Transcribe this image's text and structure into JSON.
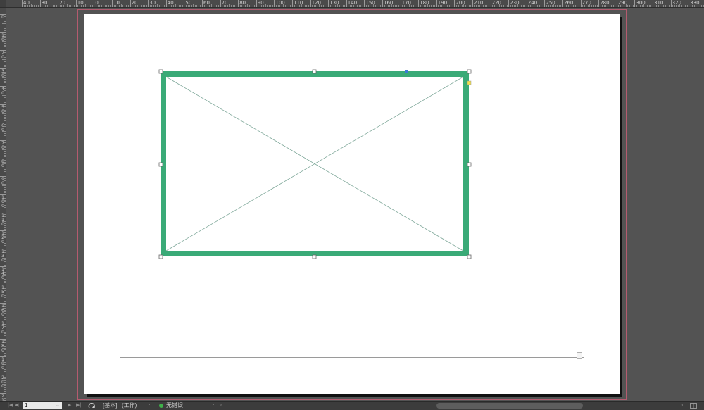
{
  "ruler": {
    "horizontal_labels": [
      "40",
      "30",
      "20",
      "10",
      "0",
      "10",
      "20",
      "30",
      "40",
      "50",
      "60",
      "70",
      "80",
      "90",
      "100",
      "110",
      "120",
      "130",
      "140",
      "150",
      "160",
      "170",
      "180",
      "190",
      "200",
      "210",
      "220",
      "230",
      "240",
      "250",
      "260",
      "270",
      "280",
      "290",
      "300",
      "310",
      "320",
      "330"
    ],
    "vertical_labels": [
      "0",
      "10",
      "20",
      "30",
      "40",
      "50",
      "60",
      "70",
      "80",
      "90",
      "100",
      "110",
      "120",
      "130",
      "140",
      "150",
      "160",
      "170",
      "180",
      "190",
      "200",
      "210"
    ]
  },
  "canvas": {
    "frame_color": "#3aaa77",
    "placeholder_line_color": "#7fa89a",
    "page_bg": "#ffffff",
    "pasteboard_bg": "#535353",
    "bleed_color": "#b45b6f"
  },
  "statusbar": {
    "first_page_icon": "first-page-icon",
    "prev_page_icon": "prev-page-icon",
    "page_number": "1",
    "next_page_icon": "next-page-icon",
    "last_page_icon": "last-page-icon",
    "master_label": "[基本]",
    "workspace_label": "(工作)",
    "preflight_status": "无错误",
    "preflight_color": "#3fb24a"
  }
}
